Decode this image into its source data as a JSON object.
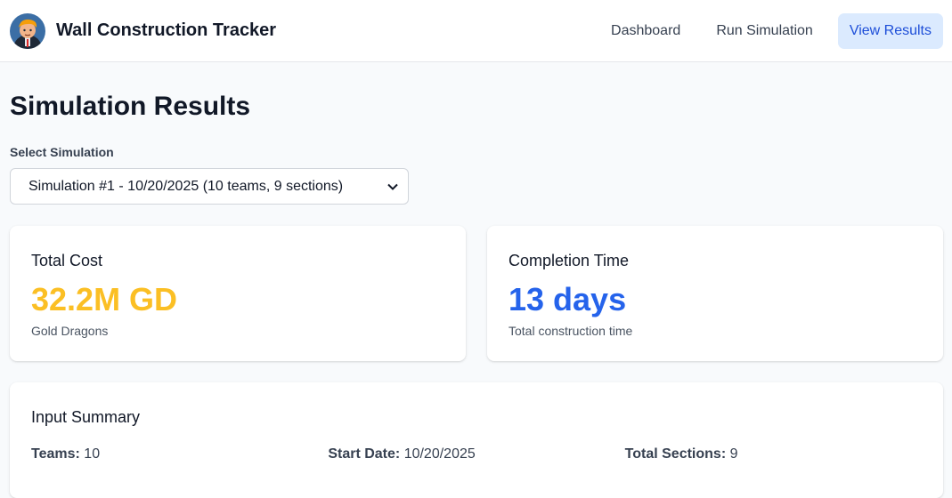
{
  "header": {
    "app_title": "Wall Construction Tracker",
    "logo_icon": "avatar-portrait-icon",
    "nav": [
      {
        "label": "Dashboard",
        "active": false
      },
      {
        "label": "Run Simulation",
        "active": false
      },
      {
        "label": "View Results",
        "active": true
      }
    ]
  },
  "main": {
    "page_title": "Simulation Results",
    "select": {
      "label": "Select Simulation",
      "selected": "Simulation #1 - 10/20/2025 (10 teams, 9 sections)",
      "chevron_icon": "chevron-down-icon"
    },
    "cost_card": {
      "title": "Total Cost",
      "value": "32.2M GD",
      "subtitle": "Gold Dragons",
      "value_color": "#fbbf24"
    },
    "time_card": {
      "title": "Completion Time",
      "value": "13 days",
      "subtitle": "Total construction time",
      "value_color": "#2563eb"
    },
    "summary": {
      "title": "Input Summary",
      "teams_label": "Teams:",
      "teams_value": "10",
      "start_label": "Start Date:",
      "start_value": "10/20/2025",
      "sections_label": "Total Sections:",
      "sections_value": "9"
    }
  },
  "colors": {
    "accent": "#1d4ed8",
    "accent_bg": "#dbeafe",
    "page_bg": "#f8fafc"
  }
}
